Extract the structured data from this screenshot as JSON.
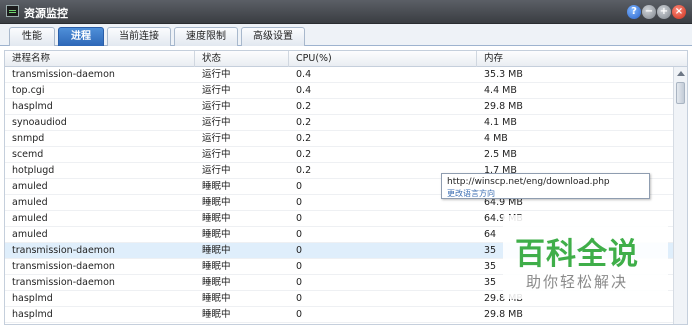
{
  "window": {
    "title": "资源监控",
    "controls": [
      "help-icon",
      "minimize-icon",
      "maximize-icon",
      "close-icon"
    ]
  },
  "tabs": [
    {
      "label": "性能",
      "active": false
    },
    {
      "label": "进程",
      "active": true
    },
    {
      "label": "当前连接",
      "active": false
    },
    {
      "label": "速度限制",
      "active": false
    },
    {
      "label": "高级设置",
      "active": false
    }
  ],
  "table": {
    "headers": [
      "进程名称",
      "状态",
      "CPU(%)",
      "内存"
    ],
    "rows": [
      {
        "name": "transmission-daemon",
        "status": "运行中",
        "cpu": "0.4",
        "mem": "35.3 MB"
      },
      {
        "name": "top.cgi",
        "status": "运行中",
        "cpu": "0.4",
        "mem": "4.4 MB"
      },
      {
        "name": "hasplmd",
        "status": "运行中",
        "cpu": "0.2",
        "mem": "29.8 MB"
      },
      {
        "name": "synoaudiod",
        "status": "运行中",
        "cpu": "0.2",
        "mem": "4.1 MB"
      },
      {
        "name": "snmpd",
        "status": "运行中",
        "cpu": "0.2",
        "mem": "4 MB"
      },
      {
        "name": "scemd",
        "status": "运行中",
        "cpu": "0.2",
        "mem": "2.5 MB"
      },
      {
        "name": "hotplugd",
        "status": "运行中",
        "cpu": "0.2",
        "mem": "1.7 MB"
      },
      {
        "name": "amuled",
        "status": "睡眠中",
        "cpu": "0",
        "mem": ""
      },
      {
        "name": "amuled",
        "status": "睡眠中",
        "cpu": "0",
        "mem": "64.9 MB"
      },
      {
        "name": "amuled",
        "status": "睡眠中",
        "cpu": "0",
        "mem": "64.9 MB"
      },
      {
        "name": "amuled",
        "status": "睡眠中",
        "cpu": "0",
        "mem": "64"
      },
      {
        "name": "transmission-daemon",
        "status": "睡眠中",
        "cpu": "0",
        "mem": "35"
      },
      {
        "name": "transmission-daemon",
        "status": "睡眠中",
        "cpu": "0",
        "mem": "35"
      },
      {
        "name": "transmission-daemon",
        "status": "睡眠中",
        "cpu": "0",
        "mem": "35"
      },
      {
        "name": "hasplmd",
        "status": "睡眠中",
        "cpu": "0",
        "mem": "29.8 MB"
      },
      {
        "name": "hasplmd",
        "status": "睡眠中",
        "cpu": "0",
        "mem": "29.8 MB"
      }
    ],
    "selected_row": 11
  },
  "tooltip": {
    "url": "http://winscp.net/eng/download.php",
    "link": "更改语言方向"
  },
  "watermark": {
    "big": "百科全说",
    "small": "助你轻松解决"
  }
}
